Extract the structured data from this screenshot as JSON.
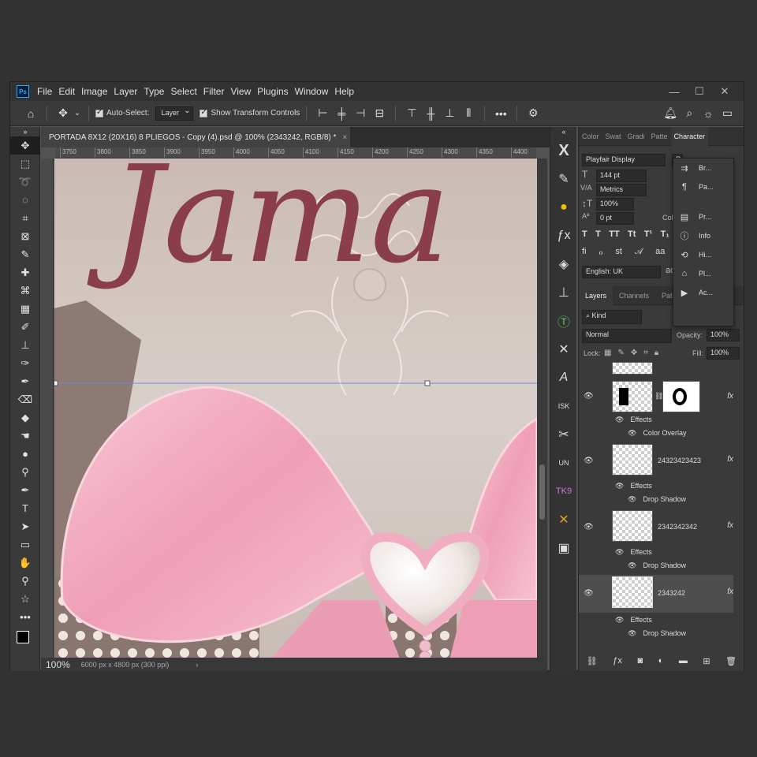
{
  "app": {
    "logo": "Ps",
    "menu": [
      "File",
      "Edit",
      "Image",
      "Layer",
      "Type",
      "Select",
      "Filter",
      "View",
      "Plugins",
      "Window",
      "Help"
    ],
    "window_controls": [
      "—",
      "☐",
      "✕"
    ]
  },
  "options_bar": {
    "auto_select_label": "Auto-Select:",
    "auto_select_target": "Layer",
    "show_transform_label": "Show Transform Controls"
  },
  "document": {
    "tab_title": "PORTADA 8X12 (20X16) 8 PLIEGOS - Copy (4).psd @ 100% (2343242, RGB/8) *",
    "tab_close": "×",
    "ruler_ticks": [
      "3750",
      "3800",
      "3850",
      "3900",
      "3950",
      "4000",
      "4050",
      "4100",
      "4150",
      "4200",
      "4250",
      "4300",
      "4350",
      "4400"
    ],
    "canvas_text": "Jama",
    "zoom": "100%",
    "doc_info": "6000 px x 4800 px (300 ppi)"
  },
  "character_panel": {
    "tabs": [
      "Color",
      "Swat",
      "Gradi",
      "Patte",
      "Character"
    ],
    "font_family": "Playfair Display",
    "font_style": "R",
    "font_size": "144 pt",
    "kerning": "Metrics",
    "vertical_scale": "100%",
    "baseline_shift": "0 pt",
    "color_label": "Color:",
    "language": "English: UK",
    "aa_label": "aɑ"
  },
  "flyout": {
    "items": [
      {
        "icon": "brush-settings-icon",
        "glyph": "⇉",
        "label": "Br..."
      },
      {
        "icon": "paragraph-icon",
        "glyph": "¶",
        "label": "Pa..."
      },
      {
        "icon": "properties-icon",
        "glyph": "▤",
        "label": "Pr..."
      },
      {
        "icon": "info-icon",
        "glyph": "ⓘ",
        "label": "Info"
      },
      {
        "icon": "history-icon",
        "glyph": "⟲",
        "label": "Hi..."
      },
      {
        "icon": "plugins-icon",
        "glyph": "⌂",
        "label": "Pl..."
      },
      {
        "icon": "actions-icon",
        "glyph": "▶",
        "label": "Ac..."
      }
    ]
  },
  "layers_panel": {
    "tabs": [
      "Layers",
      "Channels",
      "Paths"
    ],
    "filter_kind": "Kind",
    "blend_mode": "Normal",
    "opacity_label": "Opacity:",
    "opacity": "100%",
    "lock_label": "Lock:",
    "fill_label": "Fill:",
    "fill": "100%",
    "layers": [
      {
        "name": "",
        "effects_label": "Effects",
        "effect": "Color Overlay",
        "fx": "fx"
      },
      {
        "name": "24323423423",
        "effects_label": "Effects",
        "effect": "Drop Shadow",
        "fx": "fx"
      },
      {
        "name": "2342342342",
        "effects_label": "Effects",
        "effect": "Drop Shadow",
        "fx": "fx"
      },
      {
        "name": "2343242",
        "effects_label": "Effects",
        "effect": "Drop Shadow",
        "fx": "fx"
      }
    ]
  },
  "colors": {
    "accent": "#31a8ff",
    "text_burgundy": "#8a3d4a",
    "ribbon_pink": "#f2a9bd"
  }
}
